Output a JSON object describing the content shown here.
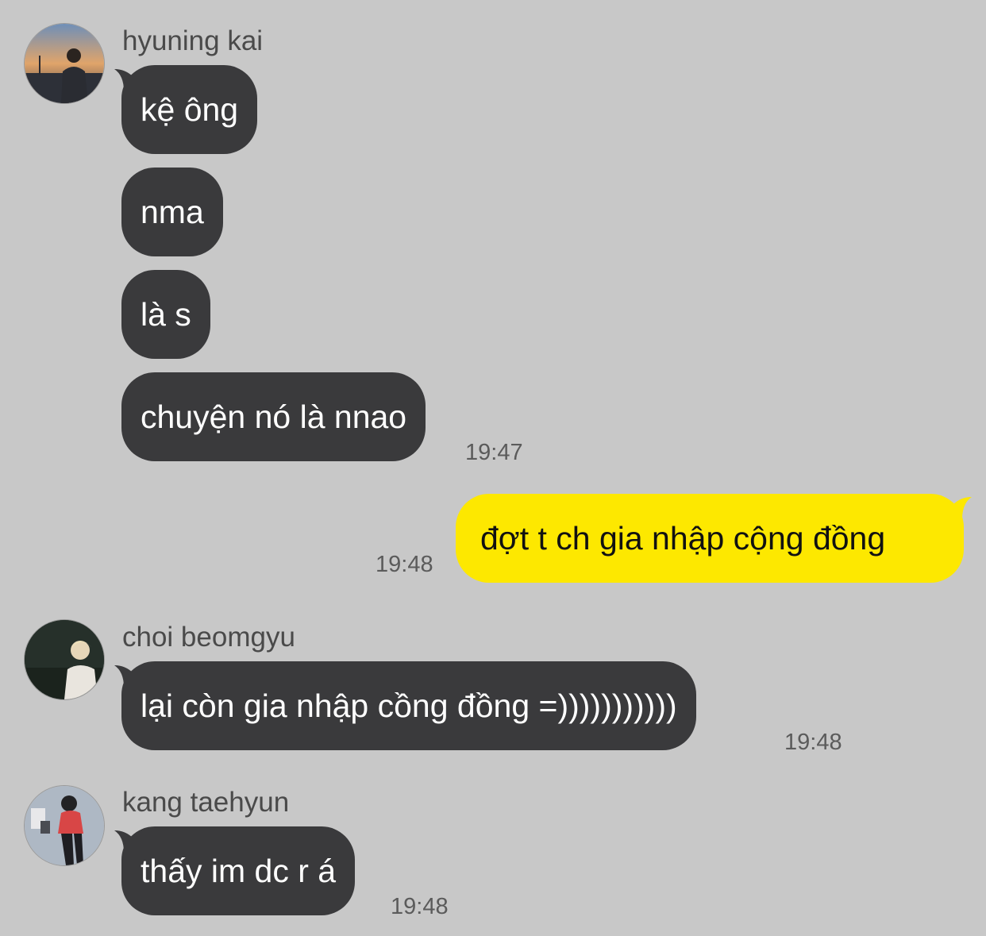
{
  "colors": {
    "background": "#c8c8c8",
    "incoming_bubble": "#3a3a3c",
    "outgoing_bubble": "#fde800",
    "sender_text": "#4a4a4a",
    "time_text": "#5b5b5b"
  },
  "messages": [
    {
      "sender": "hyuning kai",
      "avatar_icon": "profile-photo",
      "bubbles": [
        "kệ ông",
        "nma",
        "là s",
        "chuyện nó là nnao"
      ],
      "time": "19:47"
    },
    {
      "outgoing": true,
      "bubbles": [
        "đợt t ch gia nhập cộng đồng"
      ],
      "time": "19:48"
    },
    {
      "sender": "choi beomgyu",
      "avatar_icon": "profile-photo",
      "bubbles": [
        "lại còn gia nhập cồng đồng =)))))))))))"
      ],
      "time": "19:48"
    },
    {
      "sender": "kang taehyun",
      "avatar_icon": "profile-photo",
      "bubbles": [
        "thấy im dc r á"
      ],
      "time": "19:48"
    }
  ]
}
